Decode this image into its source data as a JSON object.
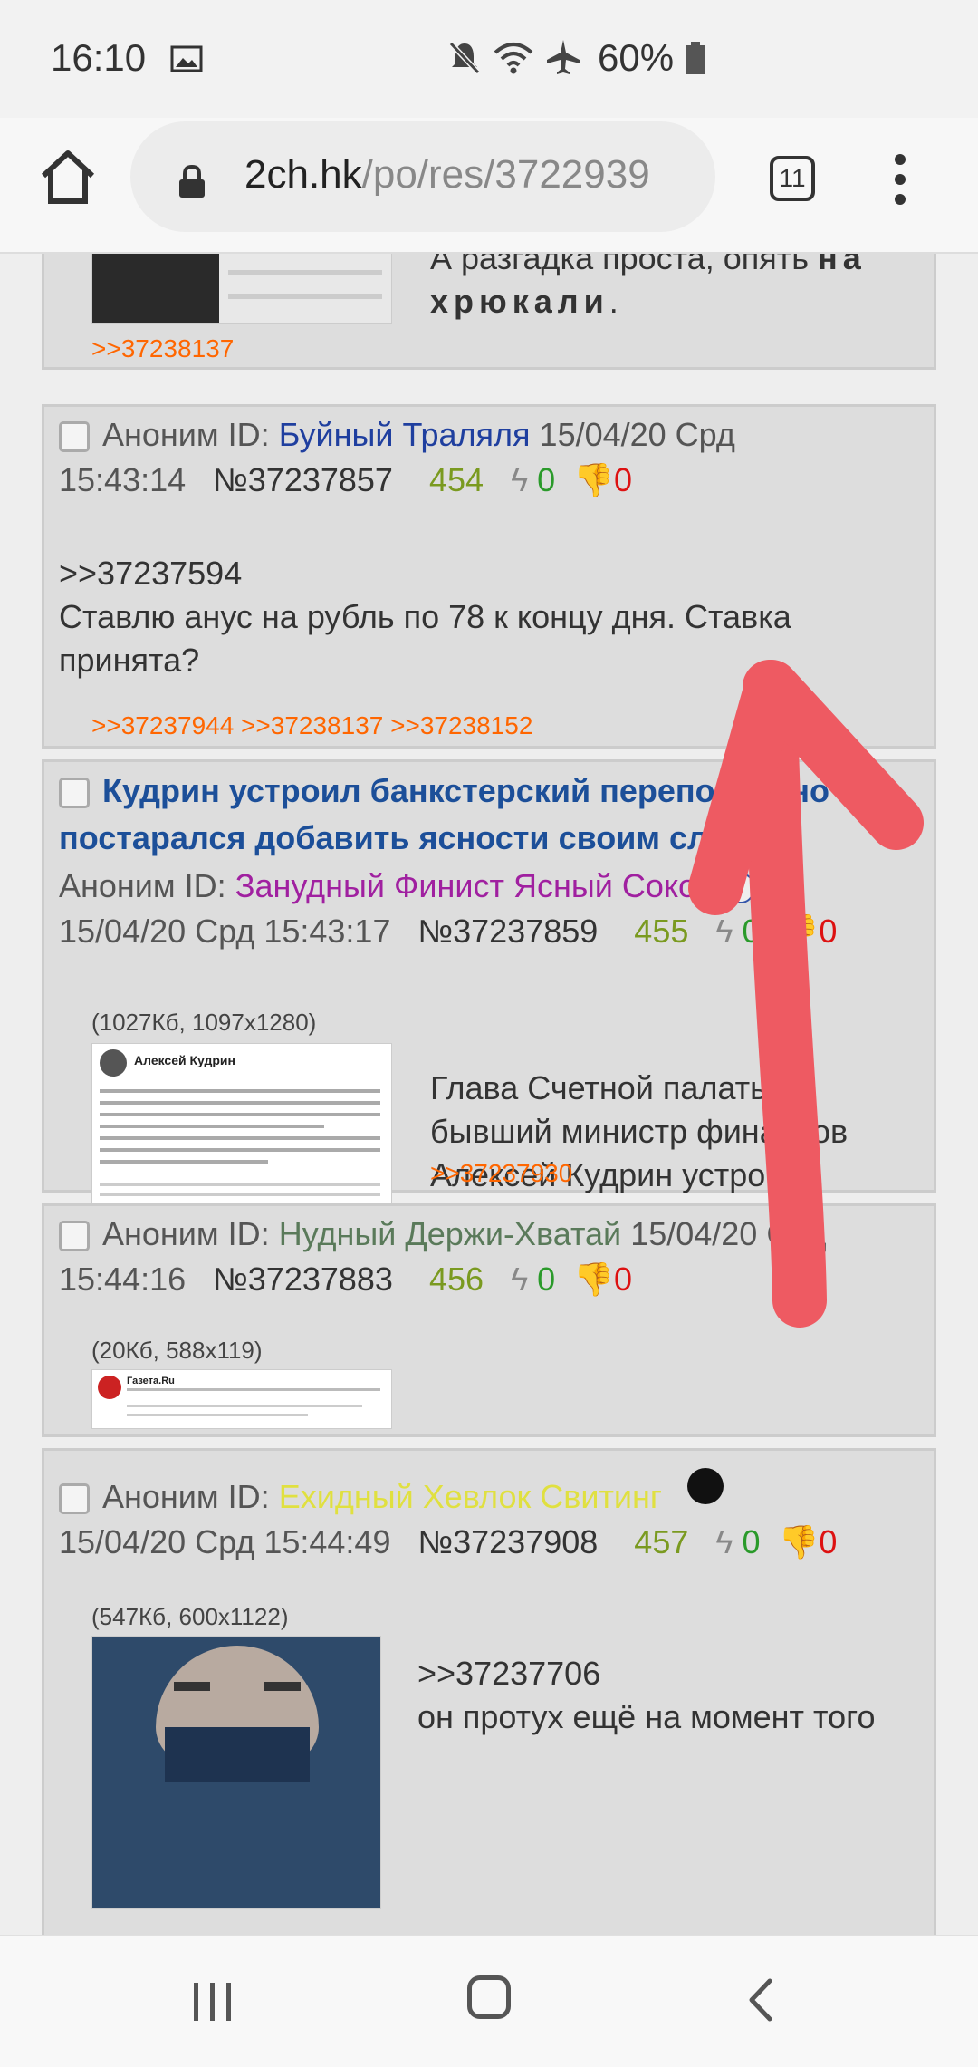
{
  "status_bar": {
    "time": "16:10",
    "battery": "60%",
    "icons": [
      "image-icon",
      "mute-icon",
      "wifi-icon",
      "airplane-icon",
      "battery-icon"
    ]
  },
  "browser": {
    "url_host": "2ch.hk",
    "url_path": "/po/res/3722939",
    "tab_count": "11"
  },
  "posts": [
    {
      "body_lines": [
        "А разгадка проста, опять ",
        "на хрюкали"
      ],
      "reply_links": ">>37238137"
    },
    {
      "author": "Аноним",
      "id_label": "ID:",
      "id_name": "Буйный Траляля",
      "datetime_a": "15/04/20 Срд",
      "datetime_b": "15:43:14",
      "number": "№37237857",
      "counter": "454",
      "likes": "0",
      "dislikes": "0",
      "quote": ">>37237594",
      "text": "Ставлю анус на рубль по 78 к концу дня. Ставка принята?",
      "replies": ">>37237944 >>37238137 >>37238152"
    },
    {
      "title": "Кудрин устроил банкстерский переполох, но постарался добавить ясности своим словам.",
      "author": "Аноним",
      "id_label": "ID:",
      "id_name": "Занудный Финист Ясный Сокол",
      "datetime": "15/04/20 Срд 15:43:17",
      "number": "№37237859",
      "counter": "455",
      "likes": "0",
      "dislikes": "0",
      "file_info": "(1027Кб, 1097x1280)",
      "thumb_author": "Алексей Кудрин",
      "text": "Глава Счетной палаты и бывший министр финансов Алексей Кудрин устроил банкстерский переполох, но постарался добавить ясности своим словам.",
      "replies": ">>37237930"
    },
    {
      "author": "Аноним",
      "id_label": "ID:",
      "id_name": "Нудный Держи-Хватай",
      "datetime_a": "15/04/20 Срд",
      "datetime_b": "15:44:16",
      "number": "№37237883",
      "counter": "456",
      "likes": "0",
      "dislikes": "0",
      "file_info": "(20Кб, 588x119)",
      "thumb_source": "Газета.Ru"
    },
    {
      "author": "Аноним",
      "id_label": "ID:",
      "id_name": "Ехидный Хевлок Свитинг",
      "datetime": "15/04/20 Срд 15:44:49",
      "number": "№37237908",
      "counter": "457",
      "likes": "0",
      "dislikes": "0",
      "file_info": "(547Кб, 600x1122)",
      "quote": ">>37237706",
      "text": "он протух ещё на момент того"
    }
  ],
  "colors": {
    "reply_link": "#ff6600",
    "title": "#1c4f99",
    "dislike": "#dd1111",
    "like": "#2a9a2a",
    "arrow": "#ee5a62"
  }
}
